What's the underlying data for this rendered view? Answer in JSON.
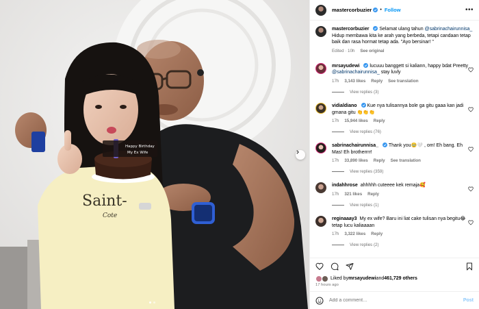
{
  "header": {
    "username": "mastercorbuzier",
    "follow_label": "Follow",
    "more_label": "•••"
  },
  "caption": {
    "username": "mastercorbuzier",
    "text_pre": "Selamat ulang tahun ",
    "mention": "@sabrinachairunnisa_",
    "text_post": " Hidup membawa kita ke arah yang berbeda, tetapi candaan tetap baik dan rasa hormat tetap ada. \"Ayo bersinar! \"",
    "edited": "Edited · 10h",
    "see_original": "See original"
  },
  "comments": [
    {
      "username": "mrsayudewi",
      "text_pre": "lucuuu banggett si kaliann, happy bdat Preetty ",
      "mention": "@sabrinachairunnisa_",
      "text_post": " stay luvly",
      "time": "17h",
      "likes": "3,143 likes",
      "reply": "Reply",
      "translate": "See translation",
      "view_replies": "View replies (3)",
      "avatar_color": "#c77b8e"
    },
    {
      "username": "vidialdiano",
      "text_pre": "Kue nya tulisannya bole ga gitu gaaa kan jadi gmana gitu 👏👏👏",
      "mention": "",
      "text_post": "",
      "time": "17h",
      "likes": "15,944 likes",
      "reply": "Reply",
      "translate": "",
      "view_replies": "View replies (76)",
      "avatar_color": "#7d6c5a"
    },
    {
      "username": "sabrinachairunnisa_",
      "text_pre": "Thank you🥹🤍 , om! Eh bang. Eh Mas! Eh brotherrrr!",
      "mention": "",
      "text_post": "",
      "time": "17h",
      "likes": "33,890 likes",
      "reply": "Reply",
      "translate": "See translation",
      "view_replies": "View replies (359)",
      "avatar_color": "#b8857a"
    },
    {
      "username": "indahhrose",
      "text_pre": "ahhhhh cuteeee kek remaja🥰",
      "mention": "",
      "text_post": "",
      "time": "17h",
      "likes": "321 likes",
      "reply": "Reply",
      "translate": "",
      "view_replies": "View replies (1)",
      "avatar_color": "#6a5a52"
    },
    {
      "username": "reginaaay3",
      "text_pre": "My ex wife? Baru ini liat cake tulisan nya begitu😂 tetap lucu kaliaaaan",
      "mention": "",
      "text_post": "",
      "time": "17h",
      "likes": "3,322 likes",
      "reply": "Reply",
      "translate": "",
      "view_replies": "View replies (2)",
      "avatar_color": "#8a6f66"
    }
  ],
  "liked": {
    "prefix": "Liked by ",
    "user": "mrsayudewi",
    "middle": " and ",
    "count": "461,729 others"
  },
  "post_time": "17 hours ago",
  "add_comment": {
    "placeholder": "Add a comment…",
    "post_label": "Post"
  },
  "photo": {
    "cake_text_1": "Happy Birthday",
    "cake_text_2": "My Ex Wife",
    "shirt_text": "Saint-",
    "shirt_text_2": "Cote"
  },
  "colors": {
    "accent": "#0095f6",
    "verified": "#3897f0",
    "link": "#00376b"
  }
}
